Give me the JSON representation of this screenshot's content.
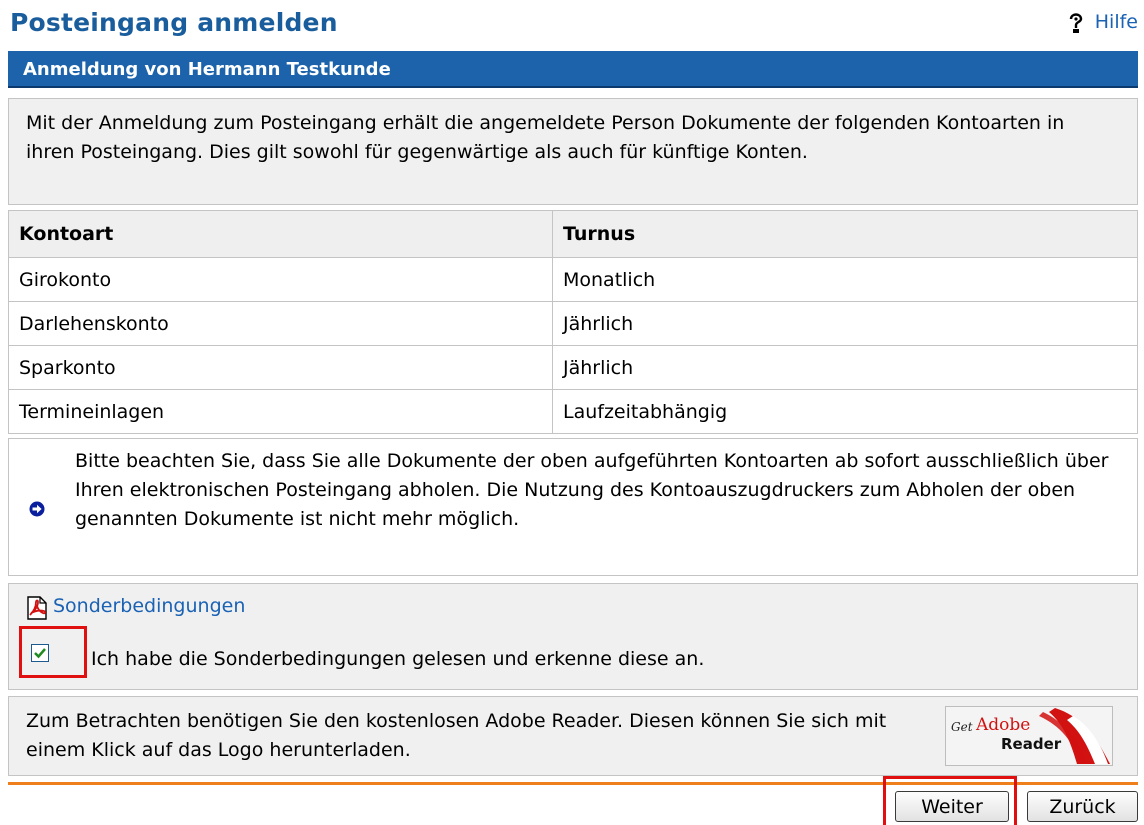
{
  "page": {
    "title": "Posteingang anmelden",
    "help_label": "Hilfe"
  },
  "section": {
    "header": "Anmeldung von Hermann Testkunde",
    "intro": "Mit der Anmeldung zum Posteingang erhält die angemeldete Person Dokumente der folgenden Kontoarten in ihren Posteingang. Dies gilt sowohl für gegenwärtige als auch für künftige Konten."
  },
  "table": {
    "headers": [
      "Kontoart",
      "Turnus"
    ],
    "rows": [
      [
        "Girokonto",
        "Monatlich"
      ],
      [
        "Darlehenskonto",
        "Jährlich"
      ],
      [
        "Sparkonto",
        "Jährlich"
      ],
      [
        "Termineinlagen",
        "Laufzeitabhängig"
      ]
    ]
  },
  "notice": {
    "text": "Bitte beachten Sie, dass Sie alle Dokumente der oben aufgeführten Kontoarten ab sofort ausschließlich über Ihren elektronischen Posteingang abholen. Die Nutzung des Kontoauszugdruckers zum Abholen der oben genannten Dokumente ist nicht mehr möglich.",
    "icon": "arrow-right-circle-icon"
  },
  "conditions": {
    "link_label": "Sonderbedingungen",
    "checkbox_label": "Ich habe die Sonderbedingungen gelesen und erkenne diese an.",
    "checked": true
  },
  "reader": {
    "text": "Zum Betrachten benötigen Sie den kostenlosen Adobe Reader. Diesen können Sie sich mit einem Klick auf das Logo herunterladen.",
    "logo_get": "Get",
    "logo_adobe": "Adobe",
    "logo_reader": "Reader"
  },
  "buttons": {
    "next": "Weiter",
    "back": "Zurück"
  },
  "colors": {
    "title": "#1a5d9c",
    "header_bg": "#1c63ab",
    "link": "#1a62b4",
    "divider": "#ee7f1a",
    "highlight": "#e01010"
  }
}
